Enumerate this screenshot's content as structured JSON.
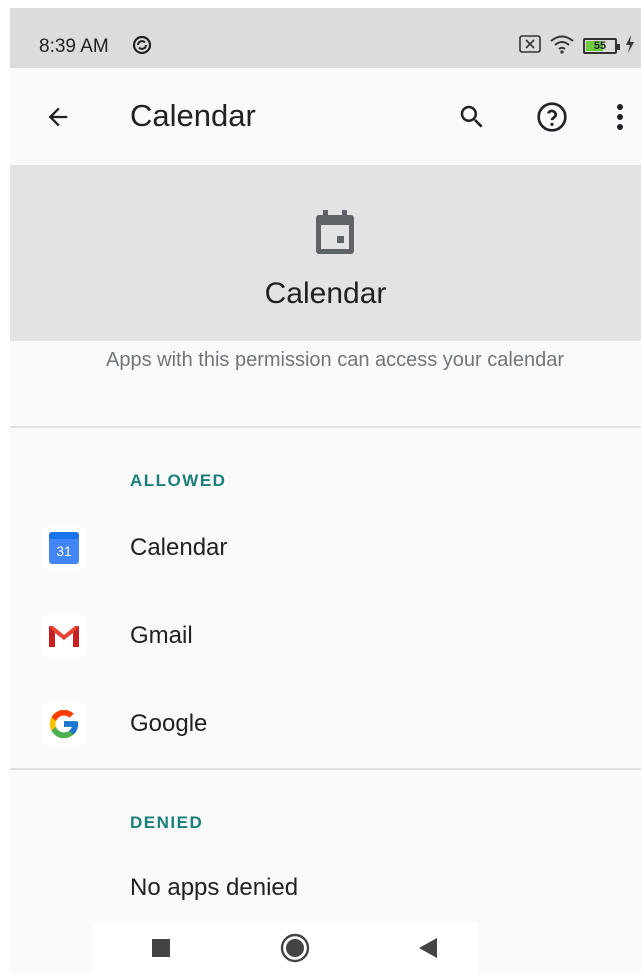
{
  "status": {
    "time": "8:39 AM",
    "battery": "55"
  },
  "appbar": {
    "title": "Calendar",
    "back_icon": "arrow-back-icon",
    "search_icon": "search-icon",
    "help_icon": "help-icon",
    "more_icon": "more-vert-icon"
  },
  "header": {
    "icon": "calendar-icon",
    "title": "Calendar",
    "description": "Apps with this permission can access your calendar"
  },
  "allowed": {
    "label": "ALLOWED",
    "apps": [
      {
        "name": "Calendar",
        "icon": "google-calendar-icon",
        "icon_text": "31"
      },
      {
        "name": "Gmail",
        "icon": "gmail-icon"
      },
      {
        "name": "Google",
        "icon": "google-icon"
      }
    ]
  },
  "denied": {
    "label": "DENIED",
    "empty_text": "No apps denied"
  },
  "navbar": {
    "recents_icon": "recents-square-icon",
    "home_icon": "home-circle-icon",
    "back_icon": "back-triangle-icon"
  },
  "colors": {
    "accent": "#1a7f7a",
    "header_bg": "#e3e3e3",
    "status_bg": "#dcdcdc"
  }
}
